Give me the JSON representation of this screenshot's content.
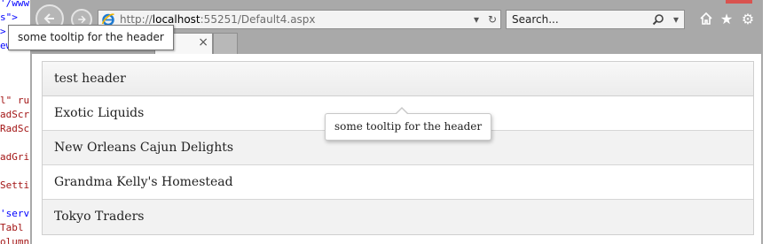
{
  "code_editor": {
    "lines": [
      {
        "text": "'/www",
        "color": "#0000ff"
      },
      {
        "text": "s\">",
        "color": "#0000ff"
      },
      {
        "text": ">",
        "color": "#0000ff"
      },
      {
        "text": "ew",
        "color": "#0000ff"
      },
      {
        "text": "l\" ru",
        "color": "#a31515"
      },
      {
        "text": "adScr",
        "color": "#a31515"
      },
      {
        "text": "RadSc",
        "color": "#a31515"
      },
      {
        "text": "adGri",
        "color": "#a31515"
      },
      {
        "text": "Setti",
        "color": "#a31515"
      },
      {
        "text": "'serv",
        "color": "#0000ff"
      },
      {
        "text": "Tabl",
        "color": "#a31515"
      },
      {
        "text": "olumn",
        "color": "#a31515"
      }
    ]
  },
  "browser": {
    "address_url_prefix": "http://",
    "address_url_host": "localhost",
    "address_url_rest": ":55251/Default4.aspx",
    "search_placeholder": "Search...",
    "icons": {
      "back": "back-arrow-icon",
      "forward": "forward-arrow-icon",
      "site": "ie-logo-icon",
      "dropdown": "dropdown-icon",
      "refresh": "refresh-icon",
      "search": "magnifier-icon",
      "home": "home-icon",
      "favorites": "star-icon",
      "settings": "gear-icon",
      "close_tab": "close-icon"
    },
    "tab_close": "×"
  },
  "tooltip_top": {
    "text": "some tooltip for the header"
  },
  "grid": {
    "header": "test header",
    "rows": [
      "Exotic Liquids",
      "New Orleans Cajun Delights",
      "Grandma Kelly's Homestead",
      "Tokyo Traders"
    ]
  },
  "tooltip_grid": {
    "text": "some tooltip for the header"
  },
  "colors": {
    "browser_chrome": "#a9a9a9",
    "accent_red": "#d9534f",
    "grid_alt_row": "#f2f2f2"
  }
}
